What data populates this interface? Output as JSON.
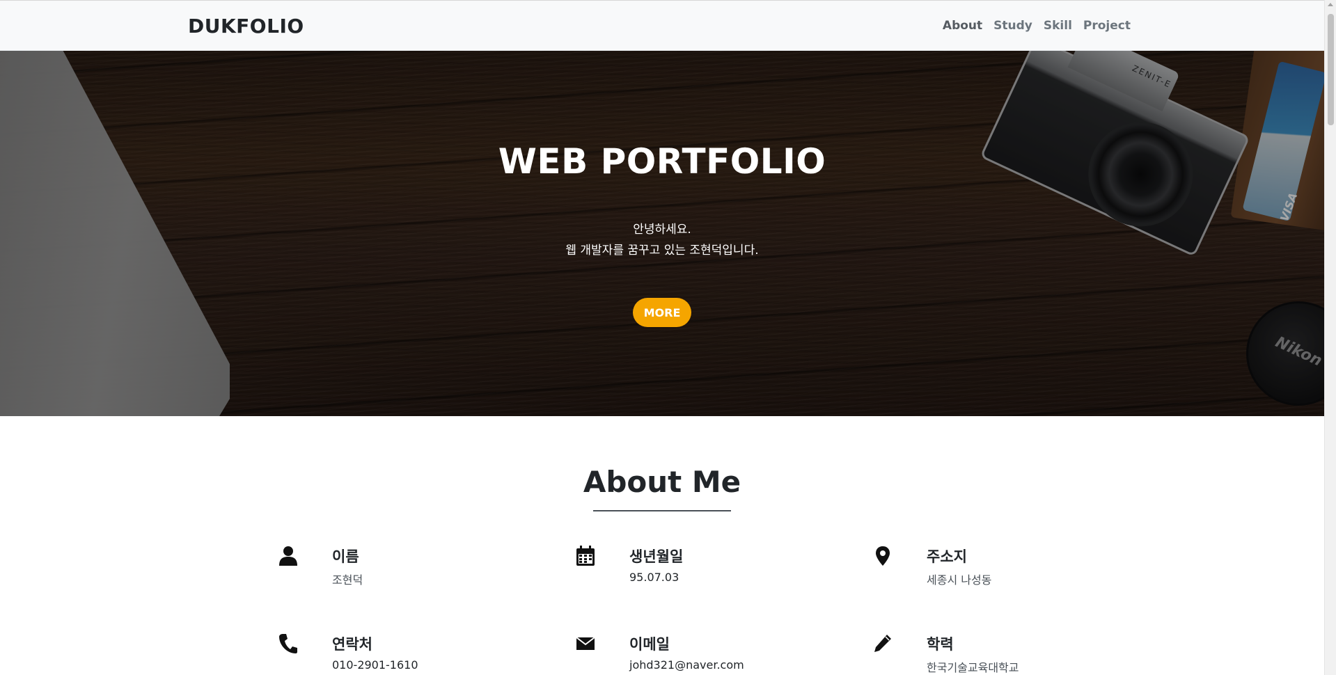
{
  "navbar": {
    "brand": "DUKFOLIO",
    "links": [
      "About",
      "Study",
      "Skill",
      "Project"
    ]
  },
  "hero": {
    "title": "WEB PORTFOLIO",
    "subtitle_line1": "안녕하세요.",
    "subtitle_line2": "웹 개발자를 꿈꾸고 있는 조현덕입니다.",
    "button_label": "MORE",
    "camera_label": "ZENIT-E",
    "card_text": "VISA",
    "lens_cap_text": "Nikon",
    "accent_color": "#f5a500"
  },
  "about": {
    "title": "About Me",
    "items": [
      {
        "icon": "person-icon",
        "label": "이름",
        "value": "조현덕"
      },
      {
        "icon": "calendar-icon",
        "label": "생년월일",
        "value": "95.07.03"
      },
      {
        "icon": "location-pin-icon",
        "label": "주소지",
        "value": "세종시 나성동"
      },
      {
        "icon": "phone-icon",
        "label": "연락처",
        "value": "010-2901-1610"
      },
      {
        "icon": "envelope-icon",
        "label": "이메일",
        "value": "johd321@naver.com"
      },
      {
        "icon": "pencil-icon",
        "label": "학력",
        "value": "한국기술교육대학교"
      }
    ]
  }
}
